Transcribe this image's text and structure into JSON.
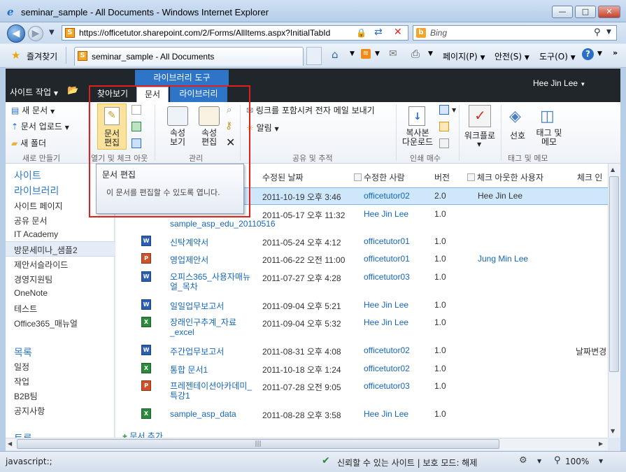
{
  "window": {
    "title": "seminar_sample - All Documents - Windows Internet Explorer",
    "minimize": "—",
    "maximize": "□",
    "close": "✕"
  },
  "addressbar": {
    "url": "https://officetutor.sharepoint.com/2/Forms/AllItems.aspx?InitialTabId",
    "search_placeholder": "Bing"
  },
  "favbar": {
    "favorites": "즐겨찾기",
    "tab_title": "seminar_sample - All Documents",
    "page_menu": "페이지(P)",
    "safety_menu": "안전(S)",
    "tools_menu": "도구(O)"
  },
  "sp": {
    "site_actions": "사이트 작업",
    "user": "Hee Jin Lee",
    "ctx_group": "라이브러리 도구",
    "tabs": {
      "browse": "찾아보기",
      "documents": "문서",
      "library": "라이브러리"
    }
  },
  "ribbon": {
    "new_doc": "새 문서",
    "upload": "문서 업로드",
    "new_folder": "새 폴더",
    "grp_new": "새로 만들기",
    "edit_doc": "문서\n편집",
    "grp_open": "열기 및 체크 아웃",
    "view_props": "속성\n보기",
    "edit_props": "속성\n편집",
    "grp_manage": "관리",
    "email_link": "링크를 포함시켜 전자 메일 보내기",
    "alert": "알림",
    "grp_share": "공유 및 추적",
    "download_copy": "복사본\n다운로드",
    "grp_copies": "인쇄 매수",
    "workflow": "워크플로",
    "favorite": "선호",
    "tags_notes": "태그 및\n메모",
    "grp_tags": "태그 및 메모"
  },
  "tooltip": {
    "title": "문서 편집",
    "body": "이 문서를 편집할 수 있도록 엽니다."
  },
  "leftnav": {
    "sites": "사이트",
    "libraries": "라이브러리",
    "library_items": [
      "사이트 페이지",
      "공유 문서",
      "IT Academy",
      "방문세미나_샘플2",
      "제안서슬라이드",
      "경영지원팀",
      "OneNote",
      "테스트",
      "Office365_매뉴얼"
    ],
    "lists": "목록",
    "list_items": [
      "일정",
      "작업",
      "B2B팀",
      "공지사항"
    ],
    "discussions": "토론"
  },
  "columns": {
    "modified": "수정된 날짜",
    "modified_by": "수정한 사람",
    "version": "버전",
    "checked_out_to": "체크 아웃한 사용자",
    "check_in": "체크 인"
  },
  "rows": [
    {
      "name": "",
      "type": "w",
      "modified": "2011-10-19 오후 3:46",
      "by": "officetutor02",
      "version": "2.0",
      "checked_out": "Hee Jin Lee",
      "extra": ""
    },
    {
      "name": "sample_asp_edu_20110516",
      "type": "w",
      "modified": "2011-05-17 오후 11:32",
      "by": "Hee Jin Lee",
      "version": "1.0",
      "checked_out": "",
      "extra": ""
    },
    {
      "name": "신탁계약서",
      "type": "w",
      "modified": "2011-05-24 오후 4:12",
      "by": "officetutor01",
      "version": "1.0",
      "checked_out": "",
      "extra": ""
    },
    {
      "name": "영업제안서",
      "type": "p",
      "modified": "2011-06-22 오전 11:00",
      "by": "officetutor01",
      "version": "1.0",
      "checked_out": "Jung Min Lee",
      "extra": ""
    },
    {
      "name": "오피스365_사용자매뉴얼_목차",
      "type": "w",
      "modified": "2011-07-27 오후 4:28",
      "by": "officetutor03",
      "version": "1.0",
      "checked_out": "",
      "extra": ""
    },
    {
      "name": "일일업무보고서",
      "type": "w",
      "modified": "2011-09-04 오후 5:21",
      "by": "Hee Jin Lee",
      "version": "1.0",
      "checked_out": "",
      "extra": ""
    },
    {
      "name": "장래인구추계_자료_excel",
      "type": "x",
      "modified": "2011-09-04 오후 5:32",
      "by": "Hee Jin Lee",
      "version": "1.0",
      "checked_out": "",
      "extra": ""
    },
    {
      "name": "주간업무보고서",
      "type": "w",
      "modified": "2011-08-31 오후 4:08",
      "by": "officetutor02",
      "version": "1.0",
      "checked_out": "",
      "extra": "날짜변경"
    },
    {
      "name": "통합 문서1",
      "type": "x",
      "modified": "2011-10-18 오후 1:24",
      "by": "officetutor02",
      "version": "1.0",
      "checked_out": "",
      "extra": ""
    },
    {
      "name": "프레젠테이션아카데미_특강1",
      "type": "p",
      "modified": "2011-07-28 오전 9:05",
      "by": "officetutor03",
      "version": "1.0",
      "checked_out": "",
      "extra": ""
    },
    {
      "name": "sample_asp_data",
      "type": "x",
      "modified": "2011-08-28 오후 3:58",
      "by": "Hee Jin Lee",
      "version": "1.0",
      "checked_out": "",
      "extra": ""
    }
  ],
  "add_doc": "문서 추가",
  "status": {
    "left": "javascript:;",
    "trust": "신뢰할 수 있는 사이트 | 보호 모드: 해제",
    "zoom": "100%"
  }
}
